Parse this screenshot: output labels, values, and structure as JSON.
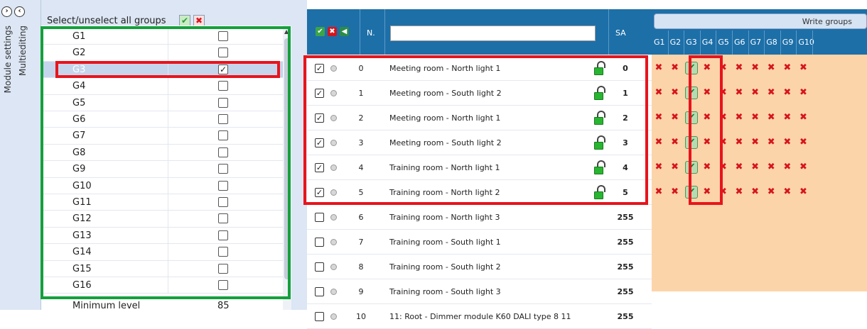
{
  "side_strip": {
    "btn_forward": "›",
    "btn_back": "‹",
    "label_module": "Module settings",
    "label_multi": "Multiediting"
  },
  "select_all": {
    "label": "Select/unselect all groups",
    "check_icon": "✔",
    "cross_icon": "✖"
  },
  "groups": [
    {
      "name": "G1",
      "checked": ""
    },
    {
      "name": "G2",
      "checked": ""
    },
    {
      "name": "G3",
      "checked": "✓"
    },
    {
      "name": "G4",
      "checked": ""
    },
    {
      "name": "G5",
      "checked": ""
    },
    {
      "name": "G6",
      "checked": ""
    },
    {
      "name": "G7",
      "checked": ""
    },
    {
      "name": "G8",
      "checked": ""
    },
    {
      "name": "G9",
      "checked": ""
    },
    {
      "name": "G10",
      "checked": ""
    },
    {
      "name": "G11",
      "checked": ""
    },
    {
      "name": "G12",
      "checked": ""
    },
    {
      "name": "G13",
      "checked": ""
    },
    {
      "name": "G14",
      "checked": ""
    },
    {
      "name": "G15",
      "checked": ""
    },
    {
      "name": "G16",
      "checked": ""
    }
  ],
  "min_level": {
    "label": "Minimum level",
    "value": "85"
  },
  "table": {
    "icon_check": "✔",
    "icon_cross": "✖",
    "icon_arrow": "◀",
    "col_n": "N.",
    "col_sa": "SA",
    "filter_value": ""
  },
  "rows": [
    {
      "checked": "✓",
      "n": "0",
      "name": "Meeting room - North light 1",
      "sa": "0"
    },
    {
      "checked": "✓",
      "n": "1",
      "name": "Meeting room - South light  2",
      "sa": "1"
    },
    {
      "checked": "✓",
      "n": "2",
      "name": "Meeting room - North light  1",
      "sa": "2"
    },
    {
      "checked": "✓",
      "n": "3",
      "name": "Meeting room - South light  2",
      "sa": "3"
    },
    {
      "checked": "✓",
      "n": "4",
      "name": "Training room - North light 1",
      "sa": "4"
    },
    {
      "checked": "✓",
      "n": "5",
      "name": "Training room - North light 2",
      "sa": "5"
    },
    {
      "checked": "",
      "n": "6",
      "name": "Training room - North light 3",
      "sa": "255"
    },
    {
      "checked": "",
      "n": "7",
      "name": "Training room - South light 1",
      "sa": "255"
    },
    {
      "checked": "",
      "n": "8",
      "name": "Training room - South light 2",
      "sa": "255"
    },
    {
      "checked": "",
      "n": "9",
      "name": "Training room - South light 3",
      "sa": "255"
    },
    {
      "checked": "",
      "n": "10",
      "name": "11: Root - Dimmer module K60  DALI type 8 11",
      "sa": "255"
    }
  ],
  "write_groups": {
    "button_label": "Write groups",
    "columns": [
      "G1",
      "G2",
      "G3",
      "G4",
      "G5",
      "G6",
      "G7",
      "G8",
      "G9",
      "G10"
    ],
    "cross_glyph": "✖",
    "check_glyph": "✔"
  },
  "colors": {
    "header_blue": "#1d6fa8",
    "panel_bg": "#dce6f4",
    "peach": "#fcd4aa",
    "highlight_red": "#e8141c",
    "highlight_green": "#14a03c",
    "selected_row": "#c5d5ec"
  }
}
